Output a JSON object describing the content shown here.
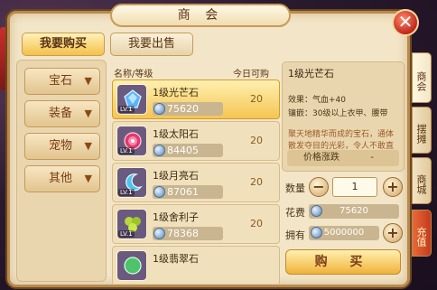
{
  "window": {
    "title": "商 会",
    "close_label": "✕"
  },
  "top_tabs": [
    {
      "label": "我要购买",
      "active": true
    },
    {
      "label": "我要出售",
      "active": false
    }
  ],
  "categories": [
    {
      "label": "宝石"
    },
    {
      "label": "装备"
    },
    {
      "label": "宠物"
    },
    {
      "label": "其他"
    }
  ],
  "list_header": {
    "name": "名称/等级",
    "today": "今日可购"
  },
  "items": [
    {
      "name": "1级光芒石",
      "price": "75620",
      "qty": "20",
      "icon": "blue-gem-icon",
      "lv": "LV.1"
    },
    {
      "name": "1级太阳石",
      "price": "84405",
      "qty": "20",
      "icon": "sun-stone-icon",
      "lv": "LV.1"
    },
    {
      "name": "1级月亮石",
      "price": "87061",
      "qty": "20",
      "icon": "moon-stone-icon",
      "lv": "LV.1"
    },
    {
      "name": "1级舍利子",
      "price": "78368",
      "qty": "20",
      "icon": "sarira-icon",
      "lv": "LV.1"
    },
    {
      "name": "1级翡翠石",
      "price": "",
      "qty": "",
      "icon": "jade-stone-icon",
      "lv": ""
    }
  ],
  "detail": {
    "title": "1级光芒石",
    "effect": "效果：气血+40",
    "inlay": "镶嵌：30级以上衣甲、腰带",
    "desc": "聚天地精华而成的宝石，通体散发夺目的光彩，令人不敢直视"
  },
  "trend": {
    "label": "价格涨跌",
    "value": "-"
  },
  "purchase": {
    "qty_label": "数量",
    "qty_value": "1",
    "cost_label": "花费",
    "cost_value": "75620",
    "own_label": "拥有",
    "own_value": "5000000",
    "buy_label": "购 买",
    "minus": "−",
    "plus": "+"
  },
  "side_tabs": [
    {
      "label": "商会",
      "active": true
    },
    {
      "label": "摆摊"
    },
    {
      "label": "商城"
    },
    {
      "label": "充值",
      "highlight": true
    }
  ],
  "colors": {
    "accent": "#f4c652",
    "panel": "#f3e6c8",
    "border": "#b98a4c",
    "recharge": "#c43a1c"
  }
}
